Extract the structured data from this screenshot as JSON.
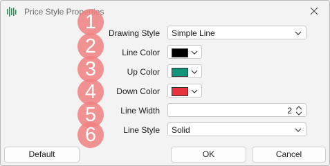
{
  "window": {
    "title": "Price Style Properties"
  },
  "rows": [
    {
      "badge": "1",
      "label": "Drawing Style",
      "value": "Simple Line"
    },
    {
      "badge": "2",
      "label": "Line Color",
      "color": "#000000"
    },
    {
      "badge": "3",
      "label": "Up Color",
      "color": "#12947a"
    },
    {
      "badge": "4",
      "label": "Down Color",
      "color": "#e8323f"
    },
    {
      "badge": "5",
      "label": "Line Width",
      "value": "2"
    },
    {
      "badge": "6",
      "label": "Line Style",
      "value": "Solid"
    }
  ],
  "buttons": {
    "default": "Default",
    "ok": "OK",
    "cancel": "Cancel"
  },
  "icons": {
    "app": "chart-bars-icon",
    "close": "close-icon",
    "dropdown": "chevron-down-icon",
    "spinner": "spinner-arrows-icon"
  },
  "colors": {
    "badge": "#f08080",
    "window_bg": "#f3f3f3"
  }
}
